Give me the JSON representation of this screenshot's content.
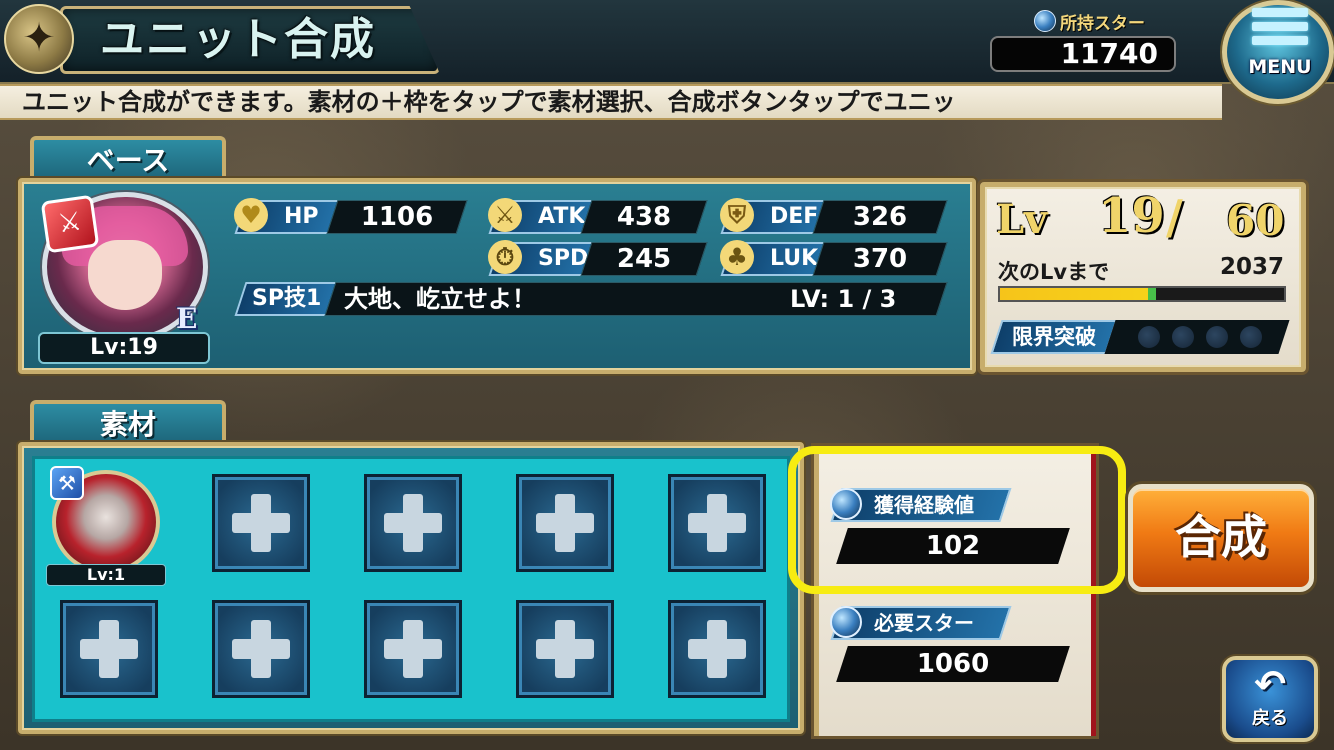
{
  "header": {
    "title": "ユニット合成",
    "stars_label": "所持スター",
    "stars_value": "11740",
    "menu_label": "MENU"
  },
  "ticker": {
    "text": "ユニット合成ができます。素材の＋枠をタップで素材選択、合成ボタンタップでユニッ"
  },
  "base": {
    "tab_label": "ベース",
    "rank": "E",
    "level_label": "Lv:19",
    "stats": {
      "hp": {
        "label": "HP",
        "value": "1106"
      },
      "atk": {
        "label": "ATK",
        "value": "438"
      },
      "def": {
        "label": "DEF",
        "value": "326"
      },
      "spd": {
        "label": "SPD",
        "value": "245"
      },
      "luk": {
        "label": "LUK",
        "value": "370"
      }
    },
    "sp": {
      "label": "SP技1",
      "name": "大地、屹立せよ！",
      "level": "LV: 1 / 3"
    }
  },
  "level_panel": {
    "lv_word": "Lv",
    "current": "19",
    "slash": "/",
    "max": "60",
    "next_label": "次のLvまで",
    "next_value": "2037",
    "exp_fraction": 0.55,
    "limit_break_label": "限界突破",
    "limit_break_slots": 4
  },
  "materials": {
    "tab_label": "素材",
    "unit_level": "Lv:1"
  },
  "info": {
    "exp_label": "獲得経験値",
    "exp_value": "102",
    "cost_label": "必要スター",
    "cost_value": "1060"
  },
  "buttons": {
    "synthesize": "合成",
    "back": "戻る"
  },
  "colors": {
    "accent_gold": "#c7ad6c",
    "highlight_yellow": "#f7ec12",
    "synth_orange": "#f07a14"
  }
}
